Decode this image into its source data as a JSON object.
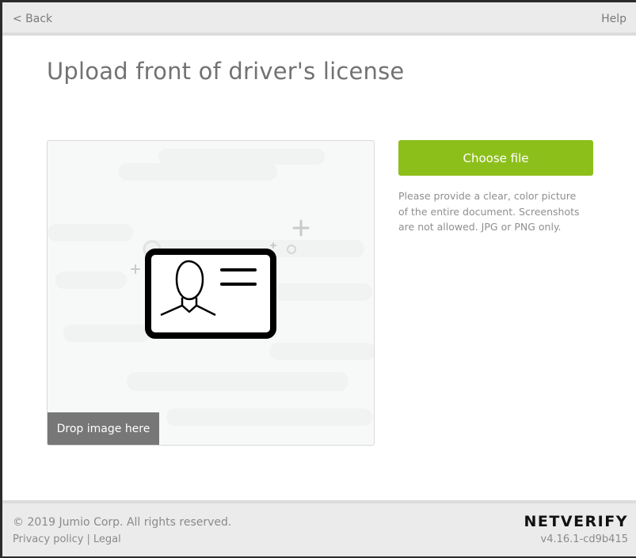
{
  "header": {
    "back_label": "< Back",
    "help_label": "Help"
  },
  "main": {
    "title": "Upload front of driver's license",
    "dropzone": {
      "icon": "id-card-icon",
      "drop_label": "Drop image here"
    },
    "choose_file_label": "Choose file",
    "instructions": "Please provide a clear, color picture of the entire document. Screenshots are not allowed. JPG or PNG only."
  },
  "footer": {
    "copyright": "© 2019 Jumio Corp. All rights reserved.",
    "privacy_label": "Privacy policy",
    "separator": "|",
    "legal_label": "Legal",
    "brand": "NETVERIFY",
    "version": "v4.16.1-cd9b415"
  },
  "colors": {
    "accent": "#8dbf1b",
    "bar_bg": "#ebebeb",
    "drop_label_bg": "#777777",
    "title_text": "#727272"
  }
}
